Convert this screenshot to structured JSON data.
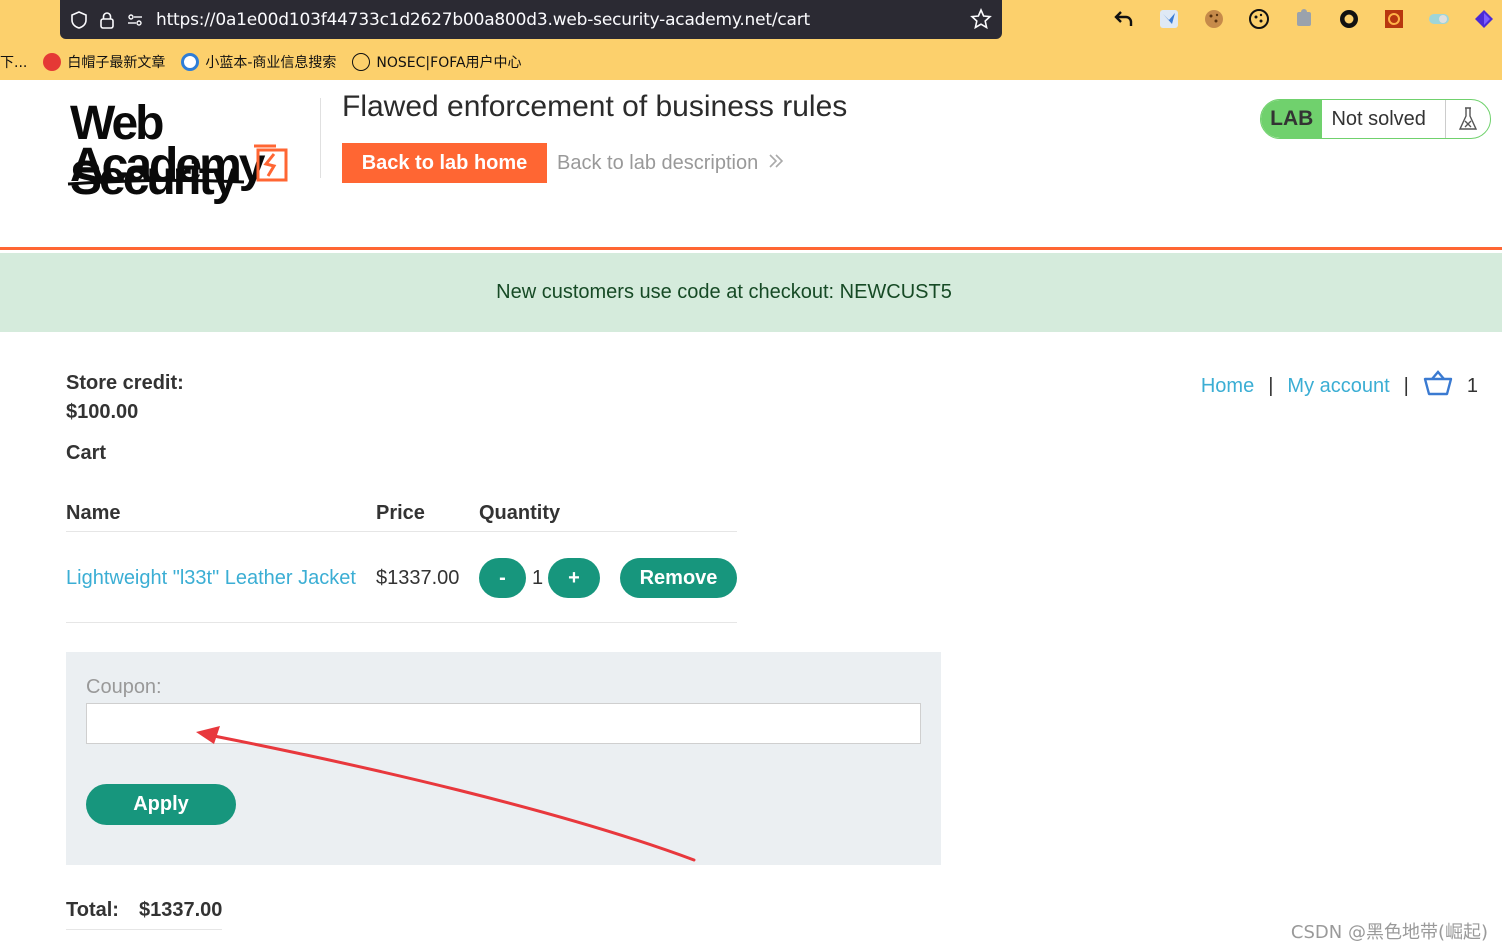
{
  "browser": {
    "url": "https://0a1e00d103f44733c1d2627b00a800d3.web-security-academy.net/cart",
    "bookmarks": [
      "白帽子最新文章",
      "小蓝本-商业信息搜索",
      "NOSEC|FOFA用户中心"
    ],
    "bookmark_overflow": "下..."
  },
  "header": {
    "logo_line1": "Web Security",
    "logo_line2": "Academy",
    "lab_title": "Flawed enforcement of business rules",
    "back_home_label": "Back to lab home",
    "back_desc_label": "Back to lab description",
    "lab_badge": "LAB",
    "lab_state": "Not solved"
  },
  "notification": "New customers use code at checkout: NEWCUST5",
  "nav": {
    "home": "Home",
    "account": "My account",
    "separator": "|",
    "cart_count": "1"
  },
  "store_credit": {
    "label": "Store credit:",
    "value": "$100.00"
  },
  "cart": {
    "title": "Cart",
    "columns": [
      "Name",
      "Price",
      "Quantity"
    ],
    "items": [
      {
        "name": "Lightweight \"l33t\" Leather Jacket",
        "price": "$1337.00",
        "quantity": "1",
        "minus": "-",
        "plus": "+",
        "remove": "Remove"
      }
    ]
  },
  "coupon": {
    "label": "Coupon:",
    "value": "",
    "apply": "Apply"
  },
  "total": {
    "label": "Total:",
    "value": "$1337.00"
  },
  "annotation": {
    "arrow_color": "#e8383d"
  },
  "watermark": "CSDN @黑色地带(崛起)"
}
